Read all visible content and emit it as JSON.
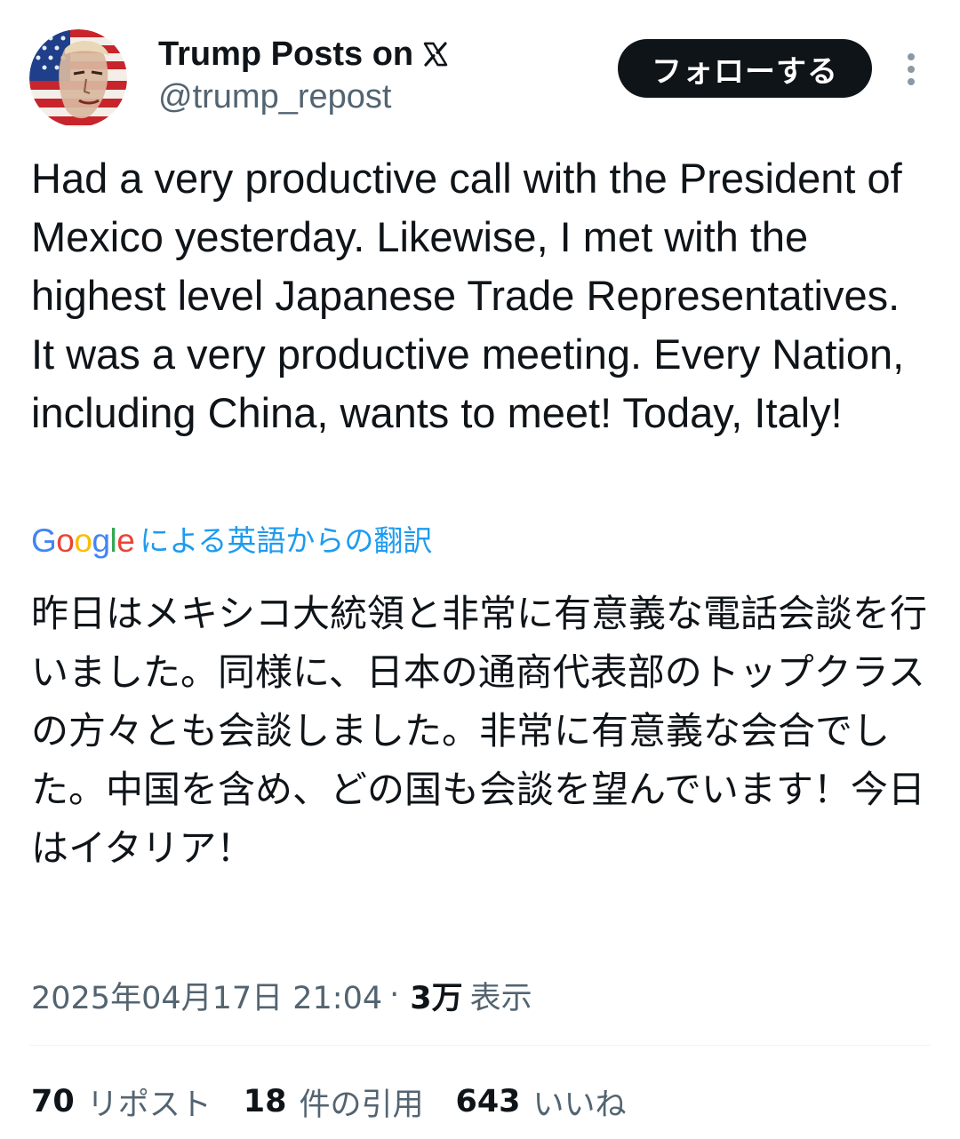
{
  "author": {
    "display_name": "Trump Posts on",
    "handle": "@trump_repost",
    "avatar_icon": "portrait-flag-avatar",
    "platform_icon": "x-logo-icon"
  },
  "actions": {
    "follow_label": "フォローする",
    "more_icon": "more-vertical-icon"
  },
  "tweet": {
    "text": "Had a very productive call with the President of Mexico yesterday. Likewise, I met with the highest level Japanese Trade Representatives. It was a very productive meeting. Every Nation, including China, wants to meet! Today, Italy!",
    "translation_provider": "Google",
    "translation_label": "による英語からの翻訳",
    "translated_text": "昨日はメキシコ大統領と非常に有意義な電話会談を行いました。同様に、日本の通商代表部のトップクラスの方々とも会談しました。非常に有意義な会合でした。中国を含め、どの国も会談を望んでいます！今日はイタリア！"
  },
  "meta": {
    "timestamp": "2025年04月17日 21:04",
    "separator": "·",
    "views_count": "3万",
    "views_label": "表示"
  },
  "stats": [
    {
      "count": "70",
      "label": "リポスト"
    },
    {
      "count": "18",
      "label": "件の引用"
    },
    {
      "count": "643",
      "label": "いいね"
    }
  ],
  "colors": {
    "text_primary": "#0f1419",
    "text_secondary": "#536471",
    "link_blue": "#1d9bf0",
    "button_bg": "#0f1419",
    "divider": "#eff3f4"
  }
}
